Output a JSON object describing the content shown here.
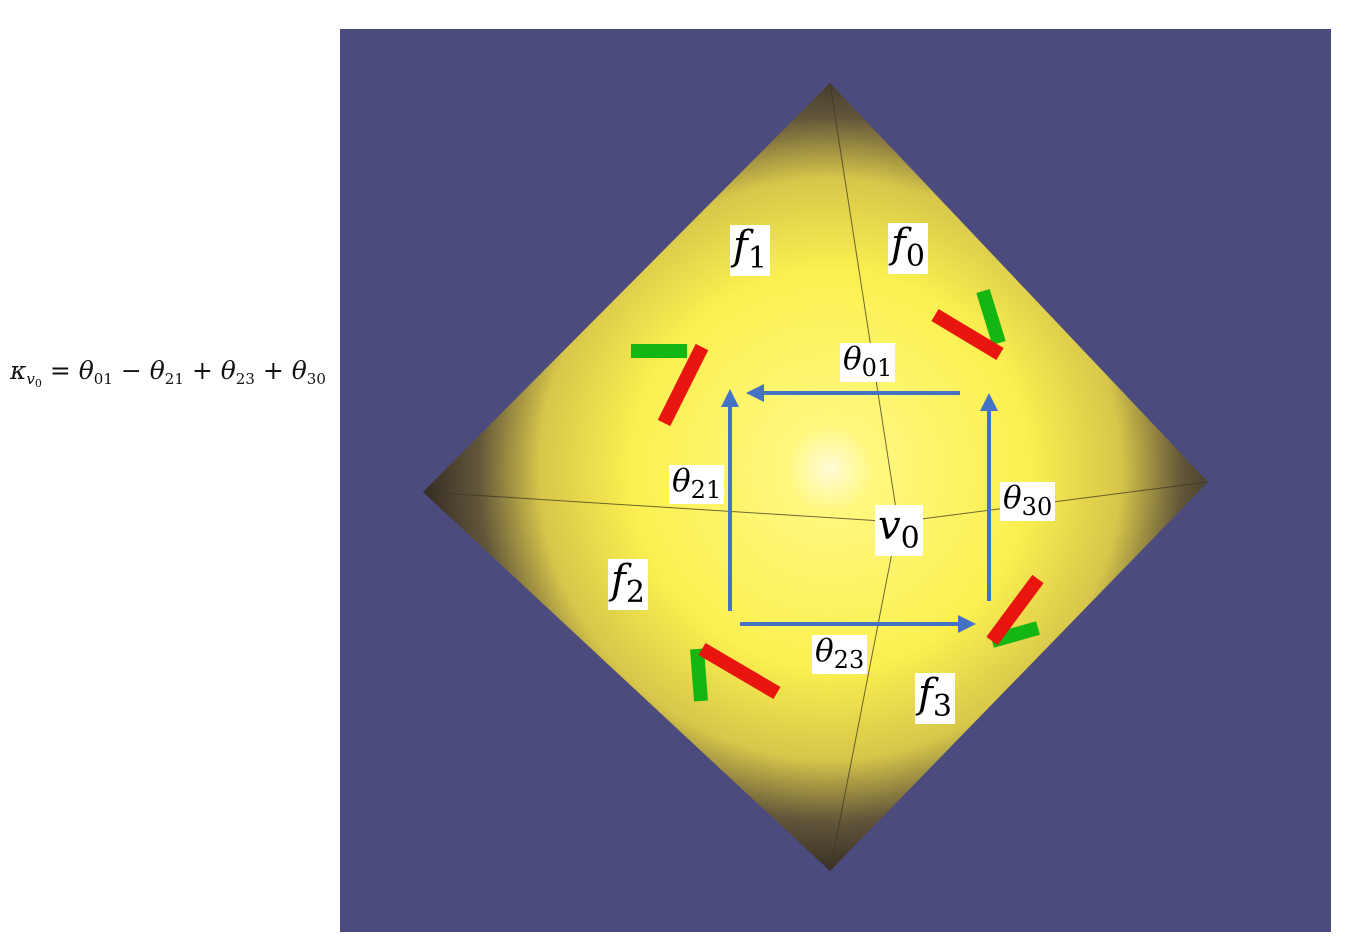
{
  "equation": {
    "kappa": "κ",
    "kappa_sub_var": "v",
    "kappa_sub_index": "0",
    "equals": " = ",
    "terms": [
      {
        "op": "",
        "symbol": "θ",
        "index": "01"
      },
      {
        "op": " − ",
        "symbol": "θ",
        "index": "21"
      },
      {
        "op": " + ",
        "symbol": "θ",
        "index": "23"
      },
      {
        "op": " + ",
        "symbol": "θ",
        "index": "30"
      }
    ]
  },
  "faces": [
    {
      "id": "f0",
      "symbol": "f",
      "index": "0"
    },
    {
      "id": "f1",
      "symbol": "f",
      "index": "1"
    },
    {
      "id": "f2",
      "symbol": "f",
      "index": "2"
    },
    {
      "id": "f3",
      "symbol": "f",
      "index": "3"
    }
  ],
  "vertex": {
    "symbol": "v",
    "index": "0"
  },
  "angles": [
    {
      "id": "theta01",
      "symbol": "θ",
      "index": "01"
    },
    {
      "id": "theta21",
      "symbol": "θ",
      "index": "21"
    },
    {
      "id": "theta23",
      "symbol": "θ",
      "index": "23"
    },
    {
      "id": "theta30",
      "symbol": "θ",
      "index": "30"
    }
  ],
  "colors": {
    "background": "#4c4b7d",
    "surface_center": "#fffbd0",
    "surface_mid": "#fdf24a",
    "surface_edge": "#372f24",
    "arrow": "#4472c4",
    "frame_x_axis": "#e8160f",
    "frame_y_axis": "#13b613"
  }
}
